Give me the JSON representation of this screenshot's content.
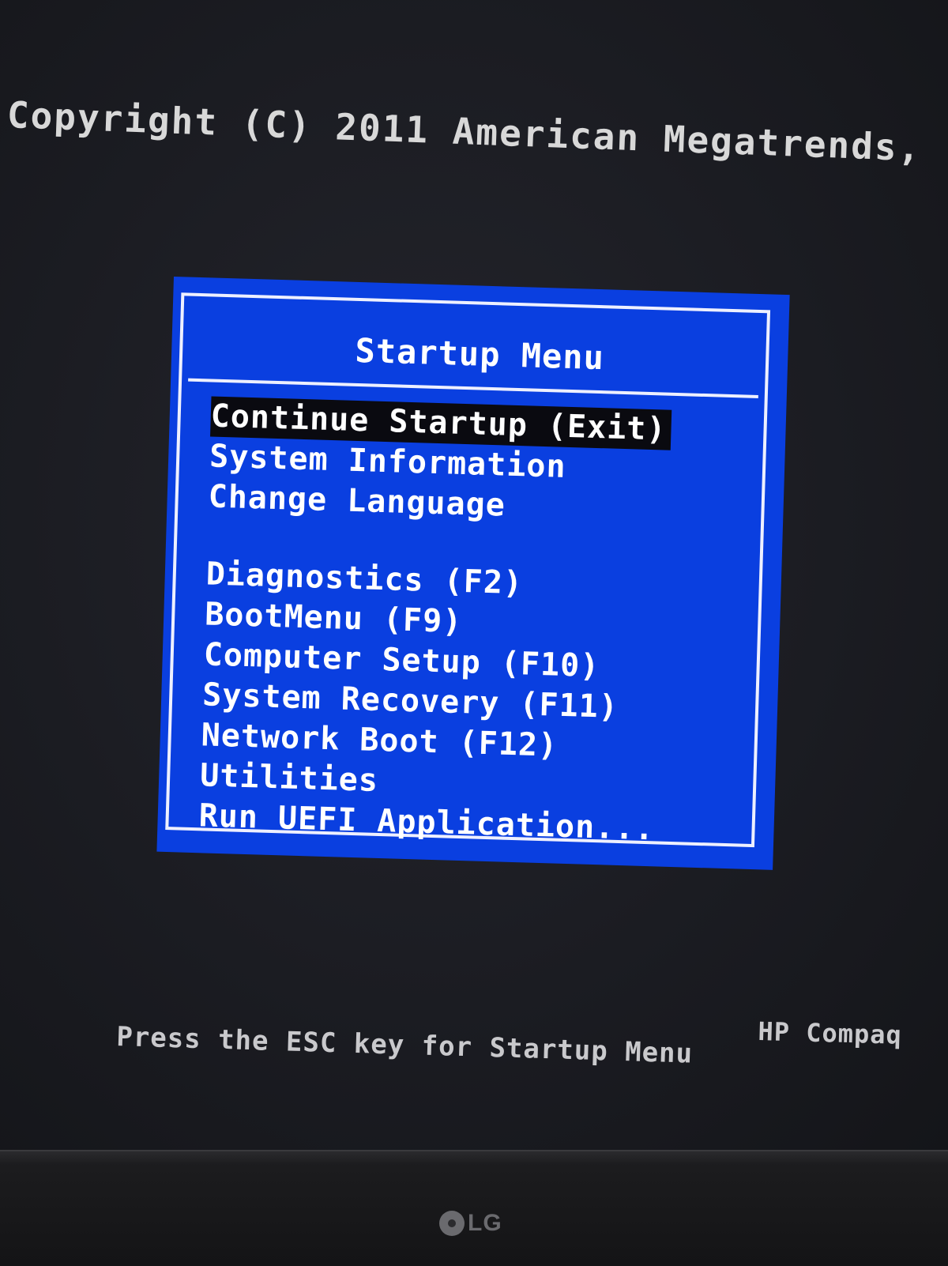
{
  "copyright": "Copyright (C) 2011 American Megatrends,",
  "menu": {
    "title": "Startup Menu",
    "items": [
      {
        "label": "Continue Startup (Exit)",
        "selected": true
      },
      {
        "label": "System Information",
        "selected": false
      },
      {
        "label": "Change Language",
        "selected": false
      },
      {
        "label": "Diagnostics (F2)",
        "selected": false
      },
      {
        "label": "BootMenu (F9)",
        "selected": false
      },
      {
        "label": "Computer Setup (F10)",
        "selected": false
      },
      {
        "label": "System Recovery (F11)",
        "selected": false
      },
      {
        "label": "Network Boot (F12)",
        "selected": false
      },
      {
        "label": "Utilities",
        "selected": false
      },
      {
        "label": "Run UEFI Application...",
        "selected": false
      }
    ]
  },
  "footer": {
    "hint": "Press the ESC key for Startup Menu",
    "brand": "HP Compaq"
  },
  "monitor": {
    "logo": "LG"
  },
  "colors": {
    "menu_background": "#0a3fe0",
    "menu_border": "#eef0ff",
    "selection_background": "#0a0a10",
    "screen_background": "#1b1c22",
    "text": "#ffffff"
  }
}
